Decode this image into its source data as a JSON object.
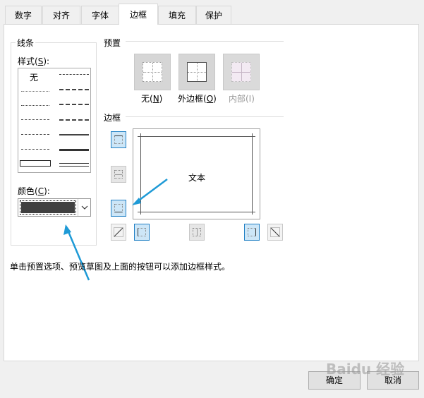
{
  "tabs": [
    {
      "label": "数字"
    },
    {
      "label": "对齐"
    },
    {
      "label": "字体"
    },
    {
      "label": "边框",
      "active": true
    },
    {
      "label": "填充"
    },
    {
      "label": "保护"
    }
  ],
  "line_group": {
    "title": "线条",
    "style_label": "样式(",
    "style_key": "S",
    "style_tail": "):",
    "none_label": "无",
    "color_label": "颜色(",
    "color_key": "C",
    "color_tail": "):",
    "color_value": "#404040"
  },
  "presets": {
    "title": "预置",
    "items": [
      {
        "label": "无(",
        "key": "N",
        "tail": ")",
        "enabled": true
      },
      {
        "label": "外边框(",
        "key": "O",
        "tail": ")",
        "enabled": true
      },
      {
        "label": "内部(I)",
        "key": "",
        "tail": "",
        "enabled": false
      }
    ]
  },
  "border": {
    "title": "边框",
    "preview_text": "文本"
  },
  "hint": "单击预置选项、预览草图及上面的按钮可以添加边框样式。",
  "buttons": {
    "ok": "确定",
    "cancel": "取消"
  },
  "colors": {
    "accent": "#1f7fc4",
    "arrow": "#1e9ad6",
    "selected_bg": "#cde6f7"
  },
  "watermark": "Baidu 经验"
}
